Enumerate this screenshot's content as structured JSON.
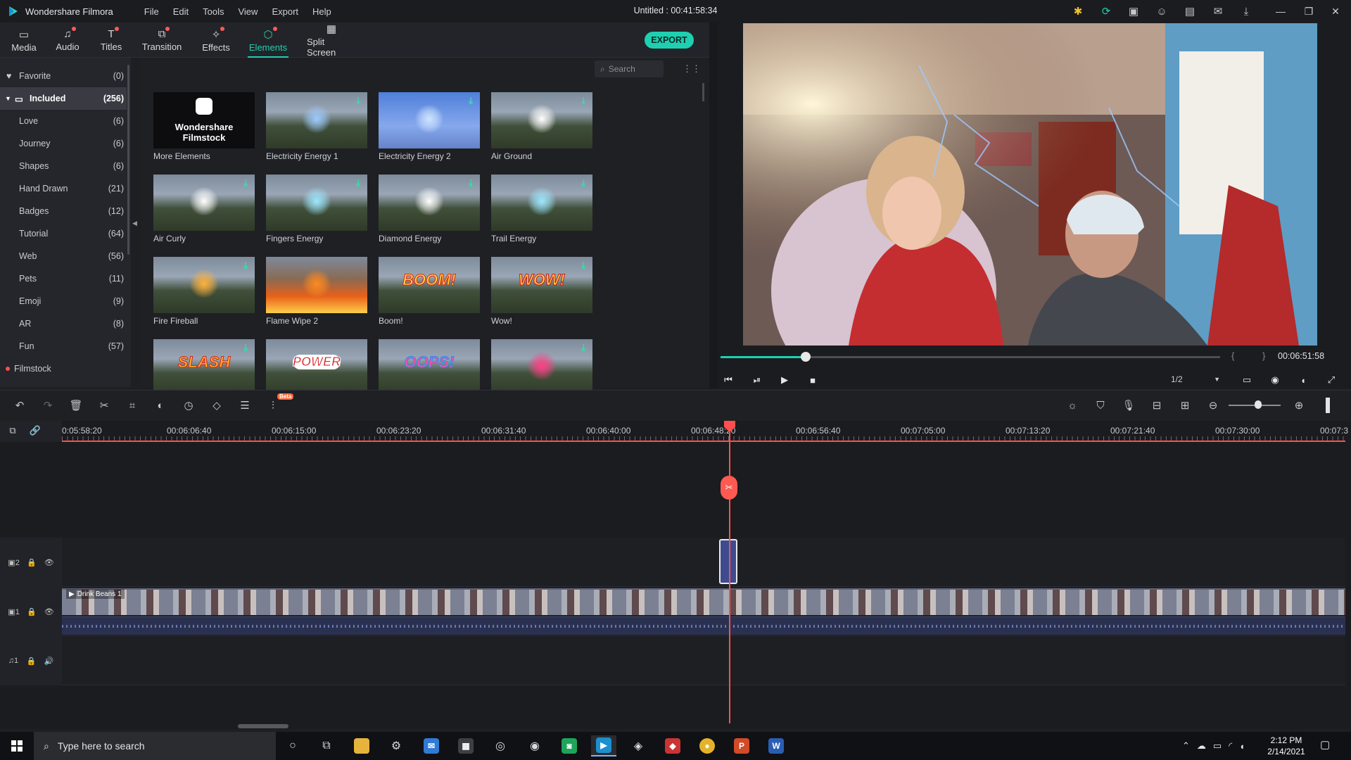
{
  "app": {
    "name": "Wondershare Filmora",
    "doc_title": "Untitled : 00:41:58:34"
  },
  "menu": [
    "File",
    "Edit",
    "Tools",
    "View",
    "Export",
    "Help"
  ],
  "tabs": [
    {
      "label": "Media",
      "icon": "folder-icon"
    },
    {
      "label": "Audio",
      "icon": "music-note-icon"
    },
    {
      "label": "Titles",
      "icon": "text-T-icon"
    },
    {
      "label": "Transition",
      "icon": "transition-icon"
    },
    {
      "label": "Effects",
      "icon": "effects-icon"
    },
    {
      "label": "Elements",
      "icon": "elements-icon"
    },
    {
      "label": "Split Screen",
      "icon": "split-screen-icon"
    }
  ],
  "export_label": "EXPORT",
  "sidebar": {
    "favorite": {
      "label": "Favorite",
      "count": "(0)"
    },
    "included": {
      "label": "Included",
      "count": "(256)"
    },
    "items": [
      {
        "label": "Love",
        "count": "(6)"
      },
      {
        "label": "Journey",
        "count": "(6)"
      },
      {
        "label": "Shapes",
        "count": "(6)"
      },
      {
        "label": "Hand Drawn",
        "count": "(21)"
      },
      {
        "label": "Badges",
        "count": "(12)"
      },
      {
        "label": "Tutorial",
        "count": "(64)"
      },
      {
        "label": "Web",
        "count": "(56)"
      },
      {
        "label": "Pets",
        "count": "(11)"
      },
      {
        "label": "Emoji",
        "count": "(9)"
      },
      {
        "label": "AR",
        "count": "(8)"
      },
      {
        "label": "Fun",
        "count": "(57)"
      }
    ],
    "filmstock": "Filmstock"
  },
  "search": {
    "placeholder": "Search"
  },
  "filmstock_card": {
    "line1": "Wondershare",
    "line2": "Filmstock"
  },
  "elements": [
    {
      "label": "More Elements"
    },
    {
      "label": "Electricity Energy 1"
    },
    {
      "label": "Electricity Energy 2"
    },
    {
      "label": "Air Ground"
    },
    {
      "label": "Air Curly"
    },
    {
      "label": "Fingers Energy"
    },
    {
      "label": "Diamond Energy"
    },
    {
      "label": "Trail Energy"
    },
    {
      "label": "Fire Fireball"
    },
    {
      "label": "Flame Wipe 2"
    },
    {
      "label": "Boom!"
    },
    {
      "label": "Wow!"
    },
    {
      "label": ""
    },
    {
      "label": ""
    },
    {
      "label": ""
    },
    {
      "label": ""
    }
  ],
  "thumb_art": {
    "boom": "BOOM!",
    "wow": "WOW!",
    "slash": "SLASH",
    "power": "POWER",
    "oops": "OOPS!"
  },
  "player": {
    "timecode": "00:06:51:58",
    "progress": 0.17,
    "ratio": "1/2",
    "brackets": "{ }"
  },
  "timeline": {
    "ticks": [
      "0:05:58:20",
      "00:06:06:40",
      "00:06:15:00",
      "00:06:23:20",
      "00:06:31:40",
      "00:06:40:00",
      "00:06:48:20",
      "00:06:56:40",
      "00:07:05:00",
      "00:07:13:20",
      "00:07:21:40",
      "00:07:30:00",
      "00:07:3"
    ],
    "clip_title": "Drink Beans 1",
    "tracks": [
      "2",
      "1",
      "1"
    ],
    "beta_label": "Beta"
  },
  "taskbar": {
    "search_placeholder": "Type here to search",
    "time": "2:12 PM",
    "date": "2/14/2021"
  }
}
